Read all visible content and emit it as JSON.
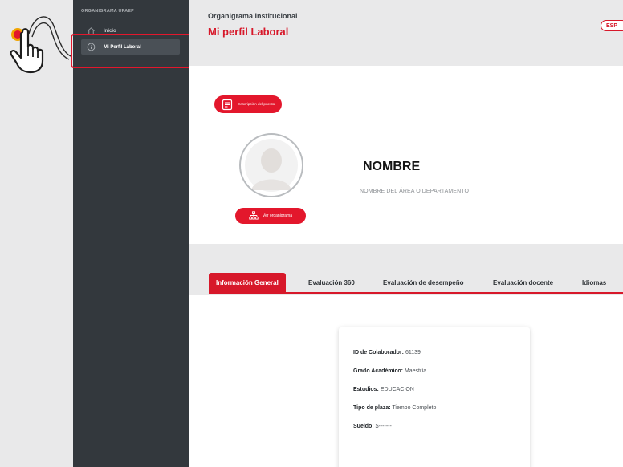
{
  "sidebar": {
    "brand": "ORGANIGRAMA UPAEP",
    "items": [
      {
        "label": "Inicio",
        "icon": "home-icon"
      },
      {
        "label": "Mi Perfil Laboral",
        "icon": "info-icon"
      }
    ]
  },
  "header": {
    "crumb": "Organigrama Institucional",
    "title": "Mi perfil Laboral",
    "lang": "ESP"
  },
  "profile": {
    "desc_button": "Descripción del puesto",
    "org_button": "Ver organigrama",
    "name": "NOMBRE",
    "department": "NOMBRE DEL ÁREA O DEPARTAMENTO"
  },
  "tabs": [
    {
      "label": "Información General",
      "active": true
    },
    {
      "label": "Evaluación 360",
      "active": false
    },
    {
      "label": "Evaluación de desempeño",
      "active": false
    },
    {
      "label": "Evaluación docente",
      "active": false
    },
    {
      "label": "Idiomas",
      "active": false
    }
  ],
  "info": {
    "id_label": "ID de Colaborador:",
    "id_value": "61139",
    "grado_label": "Grado Académico:",
    "grado_value": "Maestría",
    "estudios_label": "Estudios:",
    "estudios_value": "EDUCACION",
    "plaza_label": "Tipo de plaza:",
    "plaza_value": "Tiempo Completo",
    "sueldo_label": "Sueldo:",
    "sueldo_value": "$-------"
  },
  "colors": {
    "accent": "#d7182a",
    "sidebar": "#33383d",
    "background": "#e9e9ea"
  }
}
